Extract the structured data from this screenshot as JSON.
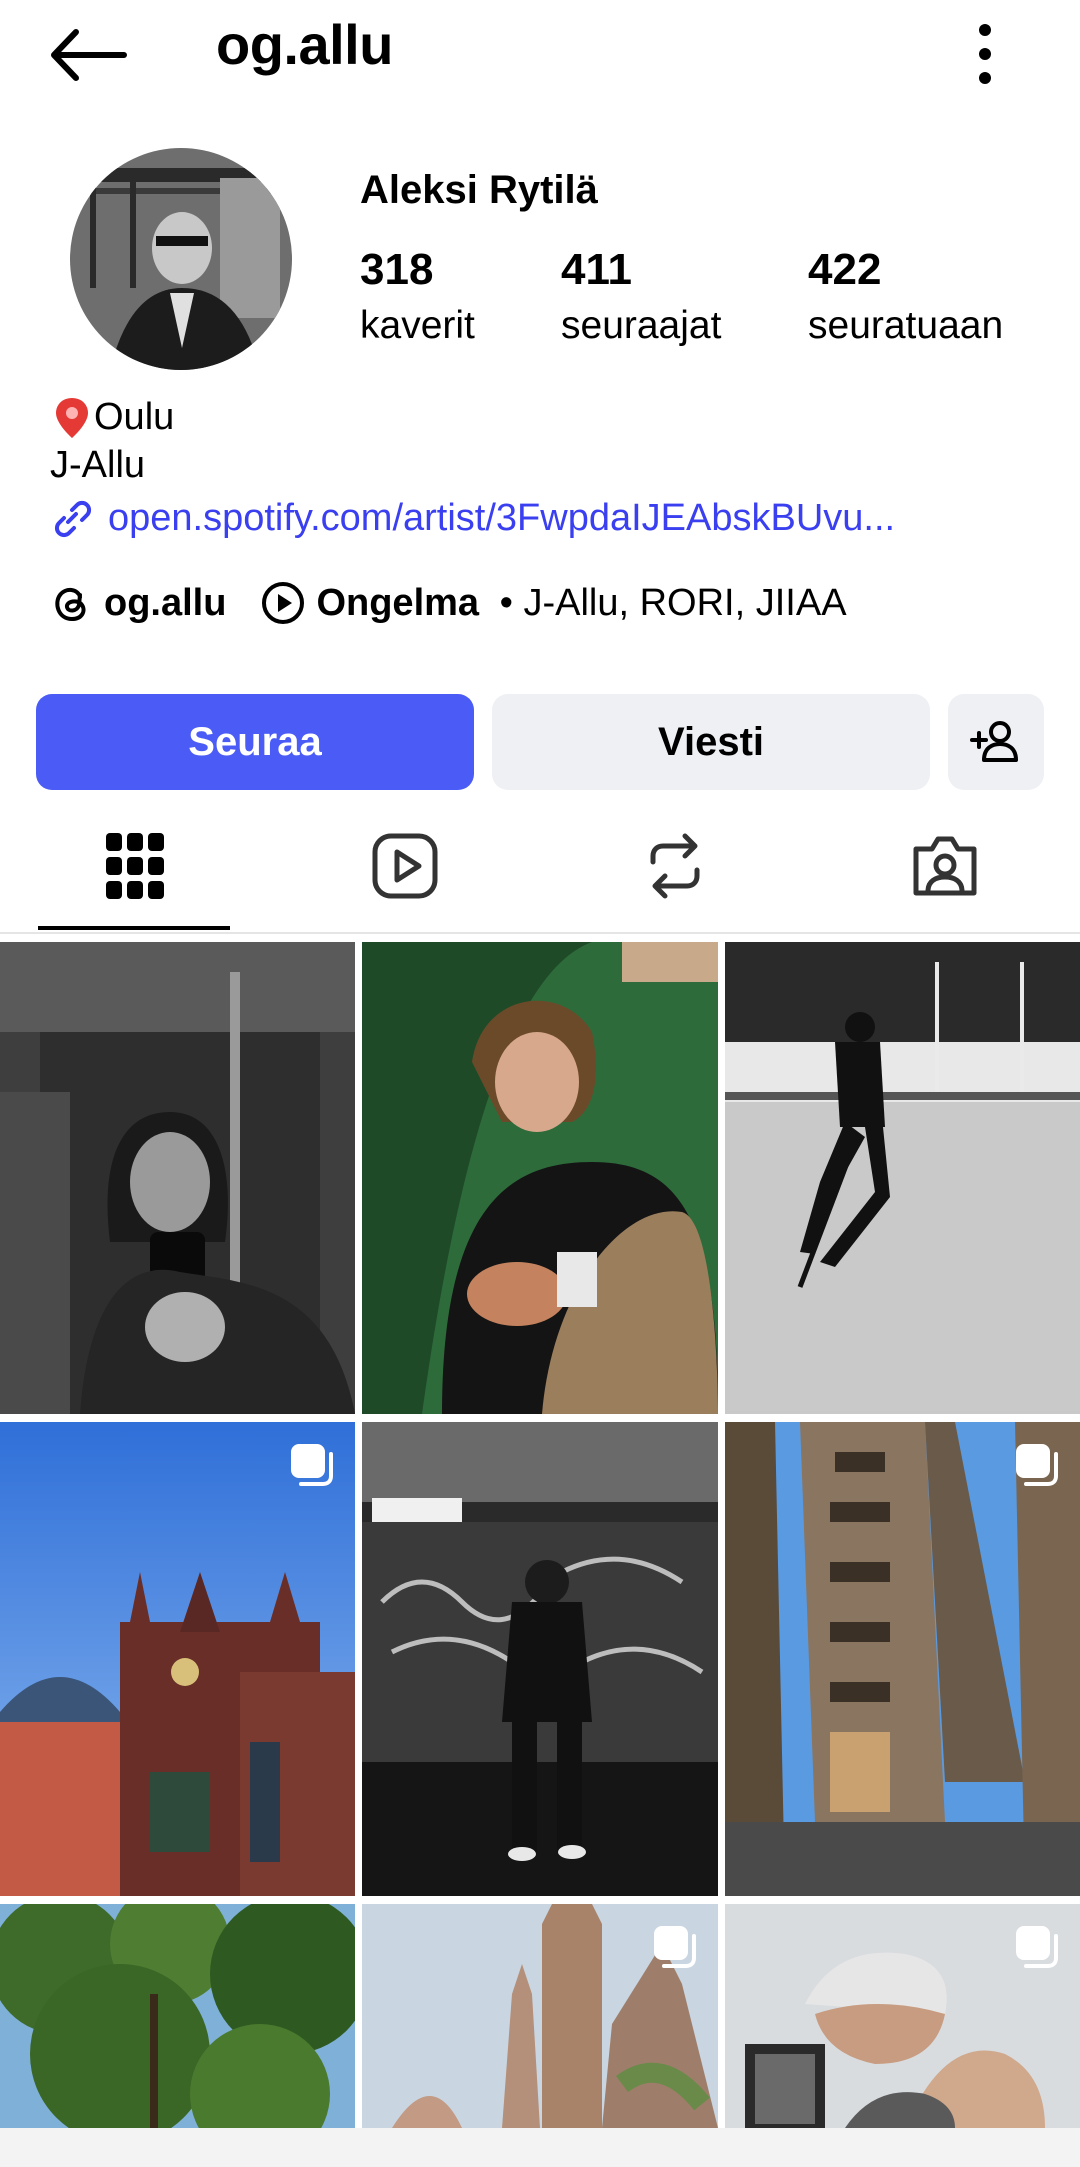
{
  "header": {
    "username": "og.allu",
    "back_icon": "arrow-left-icon",
    "more_icon": "more-vertical-icon"
  },
  "profile": {
    "name": "Aleksi Rytilä",
    "stats": [
      {
        "value": "318",
        "label": "kaverit"
      },
      {
        "value": "411",
        "label": "seuraajat"
      },
      {
        "value": "422",
        "label": "seuratuaan"
      }
    ],
    "location": "Oulu",
    "bio_line": "J-Allu",
    "link": "open.spotify.com/artist/3FwpdaIJEAbskBUvu...",
    "threads_handle": "og.allu",
    "music_title": "Ongelma",
    "music_artists": " • J-Allu, RORI, JIIAA"
  },
  "actions": {
    "follow": "Seuraa",
    "message": "Viesti",
    "add_friend_icon": "person-add-icon"
  },
  "tabs": [
    {
      "name": "posts-grid",
      "icon": "grid-icon",
      "active": true
    },
    {
      "name": "reels",
      "icon": "play-icon",
      "active": false
    },
    {
      "name": "reposts",
      "icon": "repost-icon",
      "active": false
    },
    {
      "name": "tagged",
      "icon": "tagged-photo-icon",
      "active": false
    }
  ],
  "posts": [
    {
      "desc": "elevator-mirror-selfie",
      "multi": false
    },
    {
      "desc": "sleeping-with-baby",
      "multi": false
    },
    {
      "desc": "ice-skating-rink",
      "multi": false
    },
    {
      "desc": "gothic-church-blue-sky",
      "multi": true
    },
    {
      "desc": "graffiti-underpass",
      "multi": false
    },
    {
      "desc": "city-street-building",
      "multi": true
    },
    {
      "desc": "trees-nature",
      "multi": false
    },
    {
      "desc": "cathedral-spires",
      "multi": true
    },
    {
      "desc": "couple-kiss-ultrasound",
      "multi": true
    }
  ],
  "colors": {
    "accent": "#4b5cf6",
    "link": "#3a3ff0",
    "button_secondary": "#eff0f4"
  }
}
